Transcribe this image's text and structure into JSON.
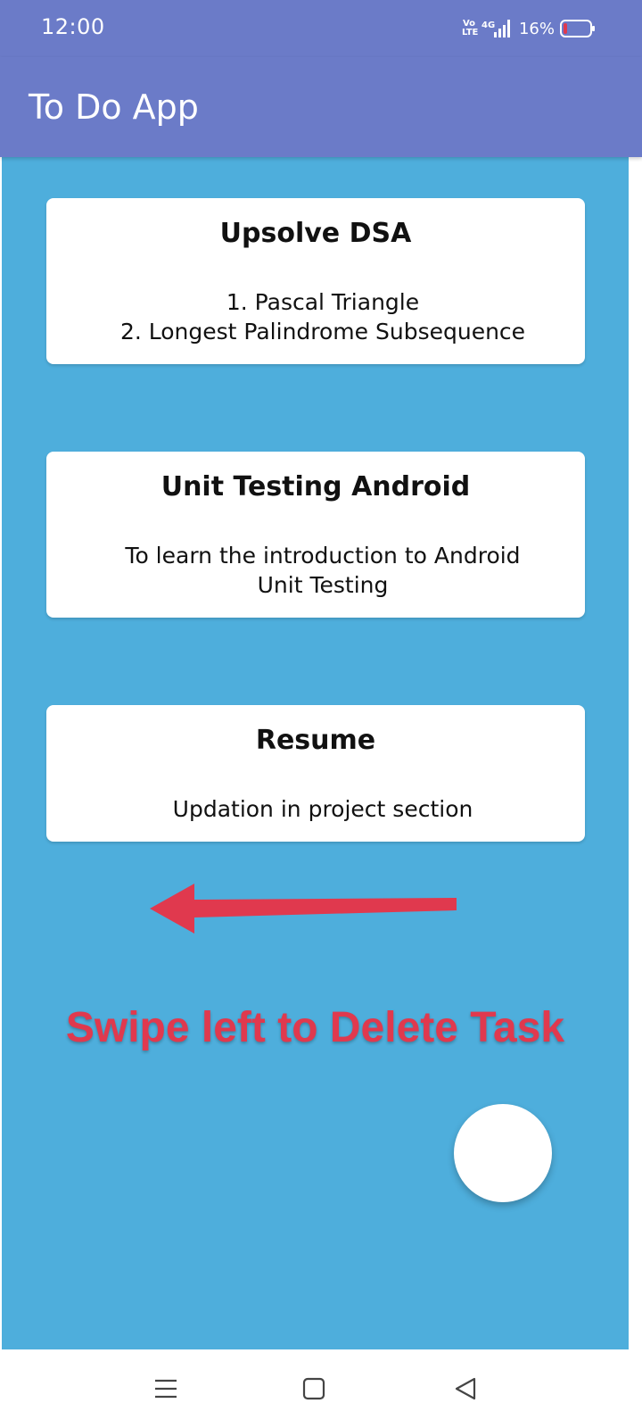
{
  "status_bar": {
    "time": "12:00",
    "network_label": "Vo\nLTE",
    "signal_label": "4G",
    "battery_percent": "16%",
    "battery_level": 0.16,
    "battery_color": "#e0394e"
  },
  "app_bar": {
    "title": "To Do App",
    "color": "#6b7bc8"
  },
  "tasks": [
    {
      "title": "Upsolve DSA",
      "description": "1. Pascal Triangle\n2. Longest Palindrome Subsequence"
    },
    {
      "title": "Unit Testing Android",
      "description": "To learn the introduction to Android Unit Testing"
    },
    {
      "title": "Resume",
      "description": "Updation in project section"
    }
  ],
  "hint": {
    "text": "Swipe left to Delete Task",
    "color": "#e0394e",
    "arrow_icon": "arrow-left-icon"
  },
  "fab": {
    "icon": "add-task-fab"
  },
  "nav_bar": {
    "icons": [
      "menu-icon",
      "home-square-icon",
      "back-triangle-icon"
    ]
  },
  "colors": {
    "content_background": "#4eaedc",
    "card_background": "#ffffff"
  }
}
